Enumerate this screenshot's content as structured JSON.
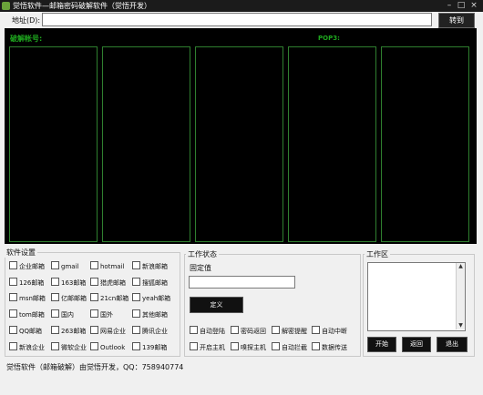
{
  "window": {
    "title": "觉悟软件—邮箱密码破解软件（觉悟开发）",
    "minimize_glyph": "–",
    "maximize_glyph": "□",
    "close_glyph": "×",
    "icon": "app-icon"
  },
  "address_bar": {
    "label": "地址(D):",
    "value": "",
    "goto_label": "转到"
  },
  "display": {
    "cracked_account_label": "破解帐号:",
    "pop3_label": "POP3:"
  },
  "software_settings": {
    "title": "软件设置",
    "options": [
      "企业邮箱",
      "gmail",
      "hotmail",
      "新浪邮箱",
      "126邮箱",
      "163邮箱",
      "猎虎邮箱",
      "搜狐邮箱",
      "msn邮箱",
      "亿邮邮箱",
      "21cn邮箱",
      "yeah邮箱",
      "tom邮箱",
      "国内",
      "国外",
      "其他邮箱",
      "QQ邮箱",
      "263邮箱",
      "网易企业",
      "腾讯企业",
      "新浪企业",
      "微软企业",
      "Outlook",
      "139邮箱"
    ]
  },
  "work_status": {
    "title": "工作状态",
    "fixed_value_label": "固定值",
    "fixed_value": "",
    "define_button": "定义",
    "options": [
      "自动登陆",
      "密码返回",
      "解密提醒",
      "自动中断",
      "开启主机",
      "嗅探主机",
      "自动拦截",
      "数据传送"
    ]
  },
  "work_area": {
    "title": "工作区",
    "log_text": "",
    "start_button": "开始",
    "back_button": "返回",
    "exit_button": "退出"
  },
  "status_bar": {
    "text": "觉悟软件（邮箱破解）由觉悟开发，QQ：758940774"
  },
  "colors": {
    "accent_green": "#1ea61e",
    "panel_border_green": "#2f7f2f",
    "black_area": "#000000",
    "titlebar": "#1b1b1b"
  }
}
